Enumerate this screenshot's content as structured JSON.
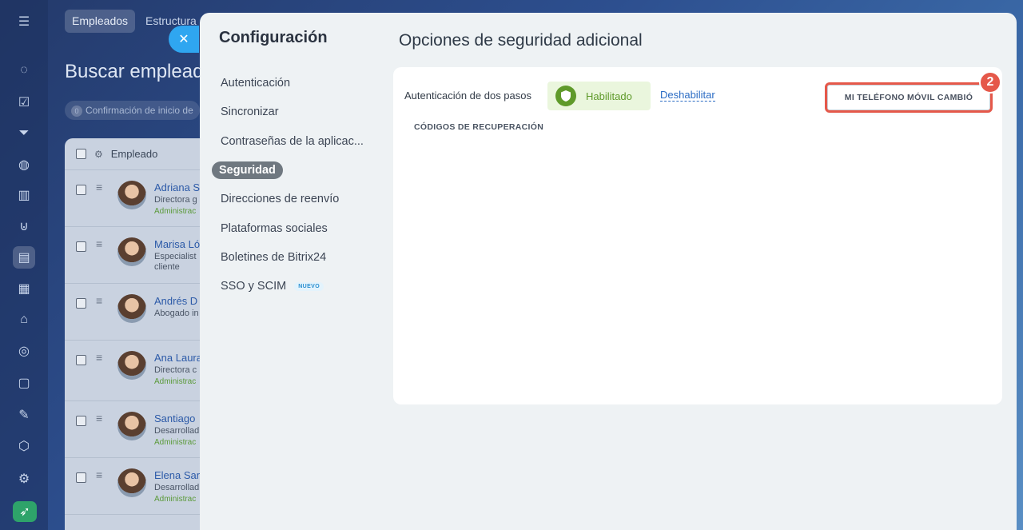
{
  "colors": {
    "accent": "#2fa6f0",
    "enabled_green": "#5f9a2a",
    "enabled_bg": "#eaf6dd",
    "link_blue": "#2b6cc4",
    "highlight_red": "#e5584a",
    "menu_active_bg": "#6f7880"
  },
  "rail": {
    "icons": [
      "menu-icon",
      "feed-icon",
      "tasks-icon",
      "filter-icon",
      "robot-icon",
      "chart-icon",
      "cart-icon",
      "employees-icon",
      "calendar-icon",
      "store-icon",
      "target-icon",
      "document-icon",
      "signature-icon",
      "box-icon",
      "settings-icon",
      "rocket-icon"
    ]
  },
  "background": {
    "tabs": [
      "Empleados",
      "Estructura"
    ],
    "page_title": "Buscar empleado",
    "filter_pill": {
      "count": "0",
      "label": "Confirmación de inicio de"
    },
    "table_header": "Empleado",
    "rows": [
      {
        "name": "Adriana S",
        "role": "Directora g",
        "dept": "Administrac"
      },
      {
        "name": "Marisa Ló",
        "role": "Especialist",
        "role2": "cliente",
        "dept": ""
      },
      {
        "name": "Andrés D",
        "role": "Abogado in",
        "dept": ""
      },
      {
        "name": "Ana Laura",
        "role": "Directora c",
        "dept": "Administrac"
      },
      {
        "name": "Santiago",
        "role": "Desarrollad",
        "dept": "Administrac"
      },
      {
        "name": "Elena San",
        "role": "Desarrollad",
        "dept": "Administrac"
      }
    ]
  },
  "panel": {
    "title": "Configuración",
    "menu": [
      {
        "label": "Autenticación"
      },
      {
        "label": "Sincronizar"
      },
      {
        "label": "Contraseñas de la aplicac..."
      },
      {
        "label": "Seguridad",
        "active": true
      },
      {
        "label": "Direcciones de reenvío"
      },
      {
        "label": "Plataformas sociales"
      },
      {
        "label": "Boletines de Bitrix24"
      },
      {
        "label": "SSO y SCIM",
        "badge": "NUEVO"
      }
    ],
    "main_title": "Opciones de seguridad adicional",
    "two_factor": {
      "label": "Autenticación de dos pasos",
      "status": "Habilitado",
      "disable_link": "Deshabilitar",
      "phone_changed_button": "MI TELÉFONO MÓVIL CAMBIÓ",
      "step_number": "2"
    },
    "recovery_codes_label": "CÓDIGOS DE RECUPERACIÓN"
  }
}
